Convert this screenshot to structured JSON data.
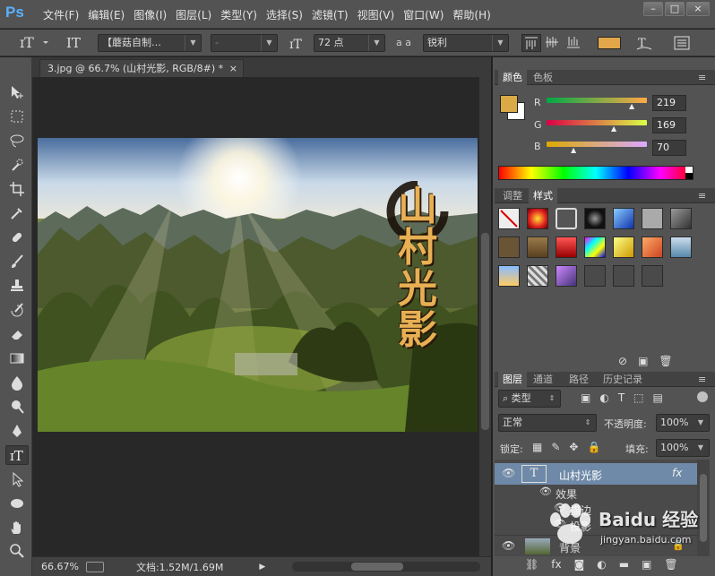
{
  "app": {
    "logo": "Ps"
  },
  "menu": [
    "文件(F)",
    "编辑(E)",
    "图像(I)",
    "图层(L)",
    "类型(Y)",
    "选择(S)",
    "滤镜(T)",
    "视图(V)",
    "窗口(W)",
    "帮助(H)"
  ],
  "window_controls": [
    "–",
    "□",
    "×"
  ],
  "options": {
    "font_family": "【蘑菇自制…",
    "font_style": "-",
    "font_size": "72 点",
    "aa_label": "a a",
    "aa_mode": "锐利",
    "text_color": "#e2a74a"
  },
  "document": {
    "tab_title": "3.jpg @ 66.7% (山村光影, RGB/8#) *",
    "tab_close": "×",
    "overlay_text": [
      "山",
      "村",
      "光",
      "影"
    ]
  },
  "status": {
    "zoom": "66.67%",
    "doc_info": "文档:1.52M/1.69M"
  },
  "color_panel": {
    "tabs": [
      "颜色",
      "色板"
    ],
    "channels": [
      {
        "label": "R",
        "value": "219"
      },
      {
        "label": "G",
        "value": "169"
      },
      {
        "label": "B",
        "value": "70"
      }
    ],
    "fg_color": "#dba946",
    "bg_color": "#ffffff"
  },
  "styles_panel": {
    "tabs": [
      "调整",
      "样式"
    ]
  },
  "layers_panel": {
    "tabs": [
      "图层",
      "通道",
      "路径",
      "历史记录"
    ],
    "filter_label": "类型",
    "blend_mode": "正常",
    "opacity_label": "不透明度:",
    "opacity": "100%",
    "lock_label": "锁定:",
    "fill_label": "填充:",
    "fill": "100%",
    "layers": [
      {
        "name": "山村光影",
        "fx": "fx"
      },
      {
        "name": "效果"
      },
      {
        "name": "描边"
      },
      {
        "name": "投影"
      },
      {
        "name": "背景"
      }
    ]
  },
  "watermark": {
    "brand": "Baidu 经验",
    "url": "jingyan.baidu.com"
  }
}
